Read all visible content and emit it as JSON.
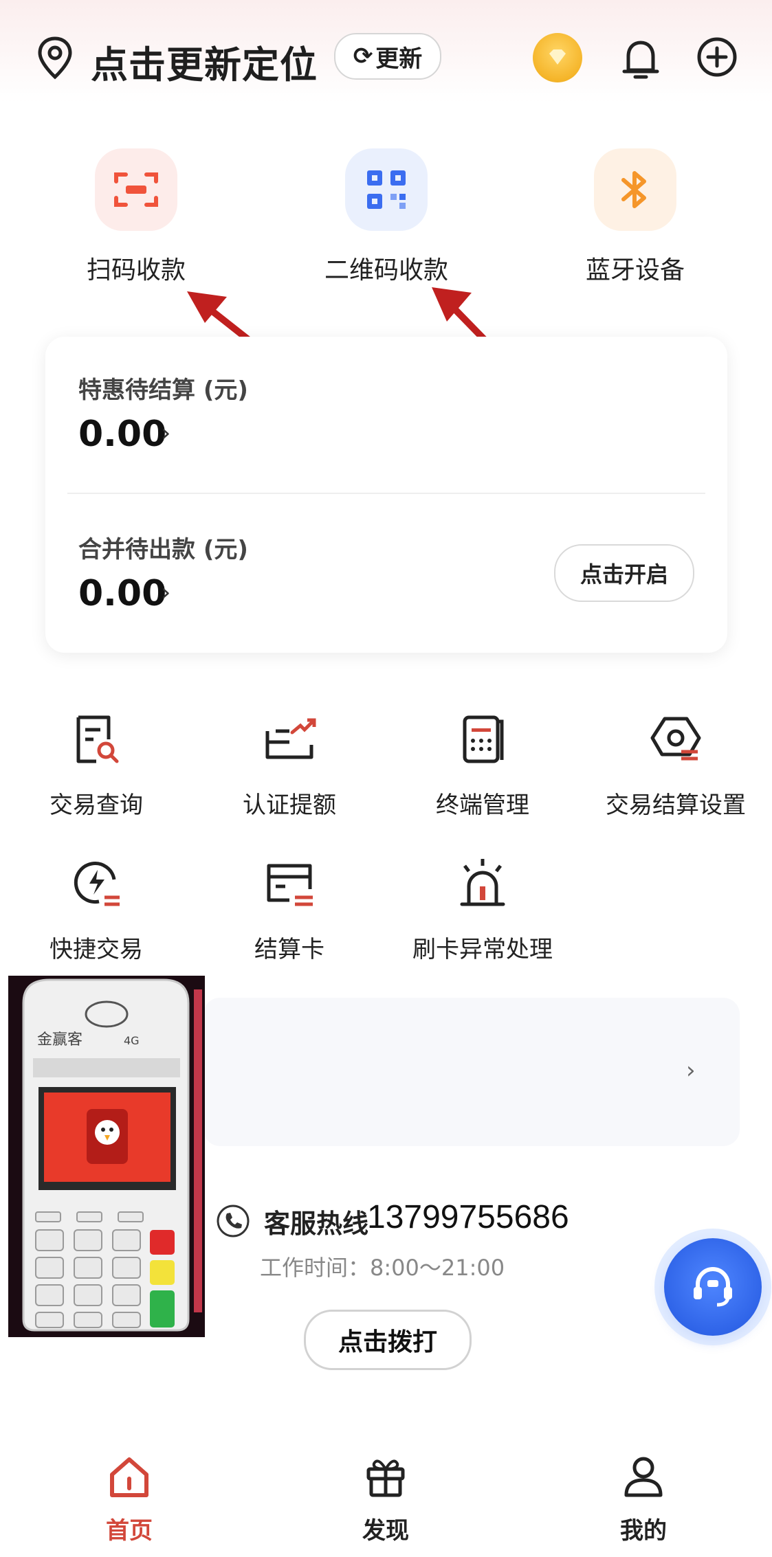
{
  "header": {
    "location_label": "点击更新定位",
    "refresh_label": "更新",
    "icons": [
      "location-pin-icon",
      "vip-badge-icon",
      "bell-icon",
      "plus-circle-icon"
    ]
  },
  "quick_actions": [
    {
      "label": "扫码收款",
      "icon": "scan-icon",
      "color": "#f0533b"
    },
    {
      "label": "二维码收款",
      "icon": "qr-code-icon",
      "color": "#3b6df0"
    },
    {
      "label": "蓝牙设备",
      "icon": "bluetooth-icon",
      "color": "#f5962a"
    }
  ],
  "balance_card": {
    "pending_settlement_label": "特惠待结算 (元)",
    "pending_settlement_amount": "0.00",
    "merged_payout_label": "合并待出款 (元)",
    "merged_payout_amount": "0.00",
    "enable_button_label": "点击开启"
  },
  "services": [
    {
      "label": "交易查询",
      "icon": "transaction-query-icon"
    },
    {
      "label": "认证提额",
      "icon": "limit-raise-icon"
    },
    {
      "label": "终端管理",
      "icon": "terminal-manage-icon"
    },
    {
      "label": "交易结算设置",
      "icon": "settlement-settings-icon"
    },
    {
      "label": "快捷交易",
      "icon": "quick-trade-icon"
    },
    {
      "label": "结算卡",
      "icon": "settlement-card-icon"
    },
    {
      "label": "刷卡异常处理",
      "icon": "alarm-icon"
    }
  ],
  "pos_device": {
    "brand_text": "金赢客",
    "network_badge": "4G"
  },
  "support": {
    "hotline_label": "客服热线",
    "hotline_number": "13799755686",
    "work_hours": "工作时间：8:00～21:00",
    "dial_button_label": "点击拨打"
  },
  "tabbar": {
    "items": [
      {
        "label": "首页",
        "icon": "home-icon",
        "active": true
      },
      {
        "label": "发现",
        "icon": "gift-icon",
        "active": false
      },
      {
        "label": "我的",
        "icon": "user-icon",
        "active": false
      }
    ]
  },
  "colors": {
    "accent_red": "#d2473a",
    "annotation_arrow": "#c0201f",
    "cs_blue": "#2f64e8",
    "vip_gold": "#f5b52a"
  }
}
